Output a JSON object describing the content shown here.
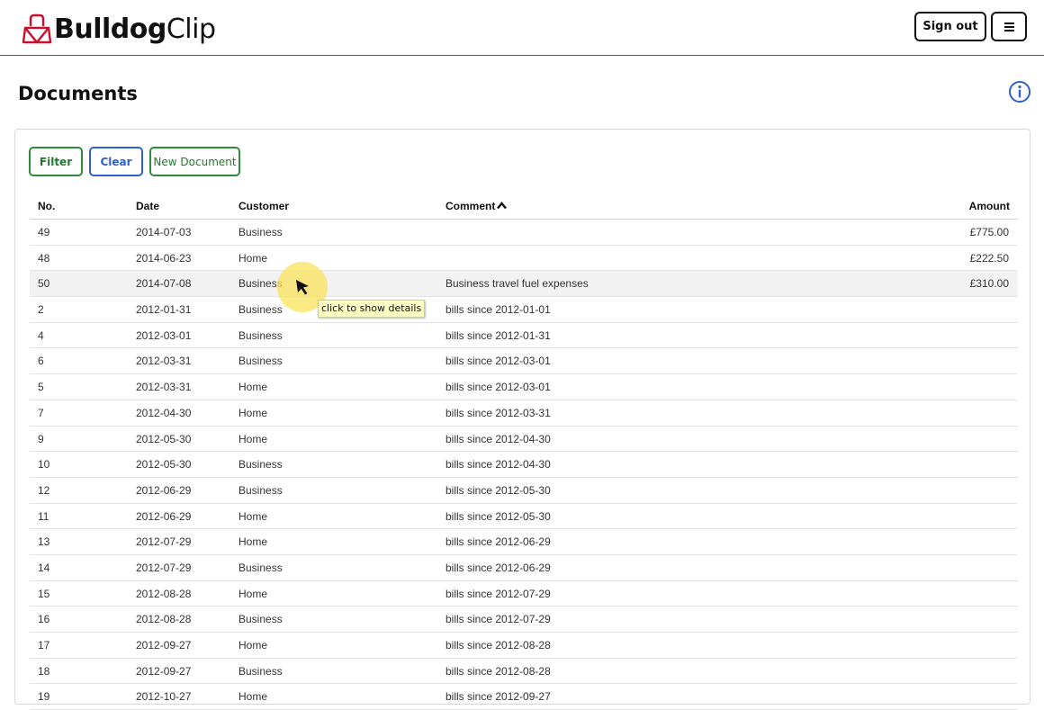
{
  "header": {
    "logo_bold": "Bulldog",
    "logo_light": "Clip",
    "signout_label": "Sign out"
  },
  "page": {
    "title": "Documents"
  },
  "toolbar": {
    "filter_label": "Filter",
    "clear_label": "Clear",
    "new_label": "New Document"
  },
  "table": {
    "headers": {
      "no": "No.",
      "date": "Date",
      "customer": "Customer",
      "comment": "Comment",
      "amount": "Amount"
    },
    "rows": [
      {
        "no": "49",
        "date": "2014-07-03",
        "customer": "Business",
        "comment": "",
        "amount": "£775.00"
      },
      {
        "no": "48",
        "date": "2014-06-23",
        "customer": "Home",
        "comment": "",
        "amount": "£222.50"
      },
      {
        "no": "50",
        "date": "2014-07-08",
        "customer": "Business",
        "comment": "Business travel fuel expenses",
        "amount": "£310.00"
      },
      {
        "no": "2",
        "date": "2012-01-31",
        "customer": "Business",
        "comment": "bills since 2012-01-01",
        "amount": ""
      },
      {
        "no": "4",
        "date": "2012-03-01",
        "customer": "Business",
        "comment": "bills since 2012-01-31",
        "amount": ""
      },
      {
        "no": "6",
        "date": "2012-03-31",
        "customer": "Business",
        "comment": "bills since 2012-03-01",
        "amount": ""
      },
      {
        "no": "5",
        "date": "2012-03-31",
        "customer": "Home",
        "comment": "bills since 2012-03-01",
        "amount": ""
      },
      {
        "no": "7",
        "date": "2012-04-30",
        "customer": "Home",
        "comment": "bills since 2012-03-31",
        "amount": ""
      },
      {
        "no": "9",
        "date": "2012-05-30",
        "customer": "Home",
        "comment": "bills since 2012-04-30",
        "amount": ""
      },
      {
        "no": "10",
        "date": "2012-05-30",
        "customer": "Business",
        "comment": "bills since 2012-04-30",
        "amount": ""
      },
      {
        "no": "12",
        "date": "2012-06-29",
        "customer": "Business",
        "comment": "bills since 2012-05-30",
        "amount": ""
      },
      {
        "no": "11",
        "date": "2012-06-29",
        "customer": "Home",
        "comment": "bills since 2012-05-30",
        "amount": ""
      },
      {
        "no": "13",
        "date": "2012-07-29",
        "customer": "Home",
        "comment": "bills since 2012-06-29",
        "amount": ""
      },
      {
        "no": "14",
        "date": "2012-07-29",
        "customer": "Business",
        "comment": "bills since 2012-06-29",
        "amount": ""
      },
      {
        "no": "15",
        "date": "2012-08-28",
        "customer": "Home",
        "comment": "bills since 2012-07-29",
        "amount": ""
      },
      {
        "no": "16",
        "date": "2012-08-28",
        "customer": "Business",
        "comment": "bills since 2012-07-29",
        "amount": ""
      },
      {
        "no": "17",
        "date": "2012-09-27",
        "customer": "Home",
        "comment": "bills since 2012-08-28",
        "amount": ""
      },
      {
        "no": "18",
        "date": "2012-09-27",
        "customer": "Business",
        "comment": "bills since 2012-08-28",
        "amount": ""
      },
      {
        "no": "19",
        "date": "2012-10-27",
        "customer": "Home",
        "comment": "bills since 2012-09-27",
        "amount": ""
      }
    ]
  },
  "tooltip": {
    "text": "click to show details"
  },
  "icons": {
    "logo": "bulldog-clip-icon",
    "menu": "hamburger-menu-icon",
    "info": "info-icon",
    "sort": "sort-ascending-icon",
    "cursor": "mouse-pointer-icon"
  },
  "colors": {
    "logo_red": "#c8102e",
    "green": "#237a2e",
    "blue": "#2f62c9"
  }
}
